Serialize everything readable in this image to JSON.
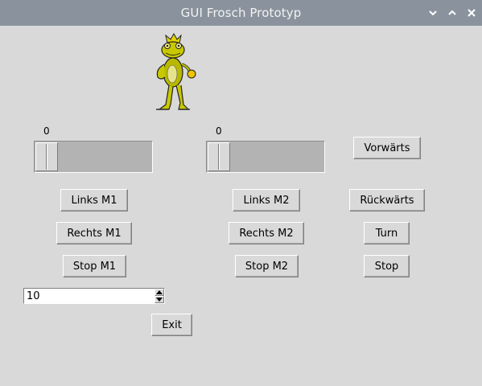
{
  "window": {
    "title": "GUI Frosch Prototyp",
    "controls": [
      "chevron-down-icon",
      "chevron-up-icon",
      "close-icon"
    ]
  },
  "image": {
    "icon": "frog-prince-image"
  },
  "motor1": {
    "scale_value": "0",
    "left_label": "Links M1",
    "right_label": "Rechts M1",
    "stop_label": "Stop M1"
  },
  "motor2": {
    "scale_value": "0",
    "left_label": "Links M2",
    "right_label": "Rechts M2",
    "stop_label": "Stop M2"
  },
  "drive": {
    "forward_label": "Vorwärts",
    "backward_label": "Rückwärts",
    "turn_label": "Turn",
    "stop_label": "Stop"
  },
  "spinbox": {
    "value": "10"
  },
  "exit_label": "Exit",
  "colors": {
    "titlebar": "#8a939d",
    "background": "#d9d9d9",
    "frog": "#c8c800"
  }
}
